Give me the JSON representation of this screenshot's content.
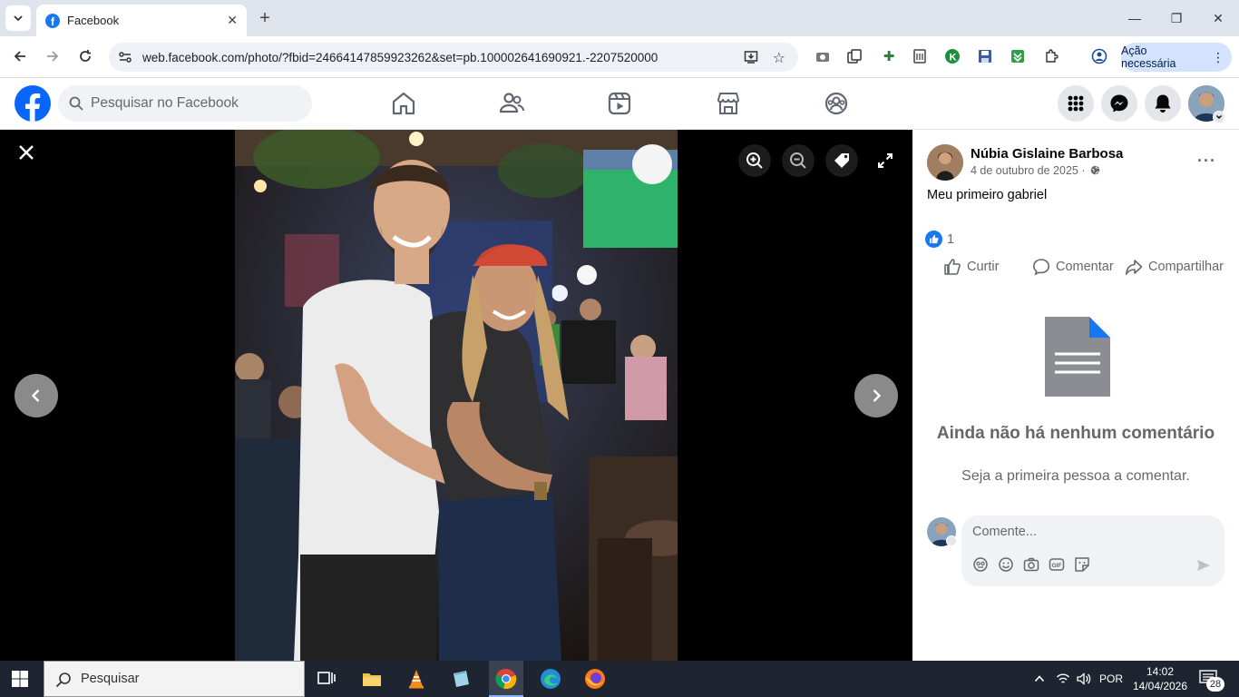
{
  "browser": {
    "tab_title": "Facebook",
    "url": "web.facebook.com/photo/?fbid=24664147859923262&set=pb.100002641690921.-2207520000",
    "action_button": "Ação necessária"
  },
  "header": {
    "search_placeholder": "Pesquisar no Facebook",
    "nav": [
      "home-icon",
      "friends-icon",
      "video-icon",
      "marketplace-icon",
      "groups-icon"
    ]
  },
  "post": {
    "author": "Núbia Gislaine Barbosa",
    "date": "4 de outubro de 2025 ·",
    "caption": "Meu primeiro gabriel",
    "reaction_count": "1",
    "actions": {
      "like": "Curtir",
      "comment": "Comentar",
      "share": "Compartilhar"
    },
    "no_comments_title": "Ainda não há nenhum comentário",
    "no_comments_sub": "Seja a primeira pessoa a comentar.",
    "comment_placeholder": "Comente..."
  },
  "taskbar": {
    "search": "Pesquisar",
    "lang": "POR",
    "time": "14:02",
    "date": "14/04/2026",
    "notifications": "28"
  },
  "colors": {
    "fb_blue": "#0866ff",
    "viewer_bg": "#000000"
  }
}
